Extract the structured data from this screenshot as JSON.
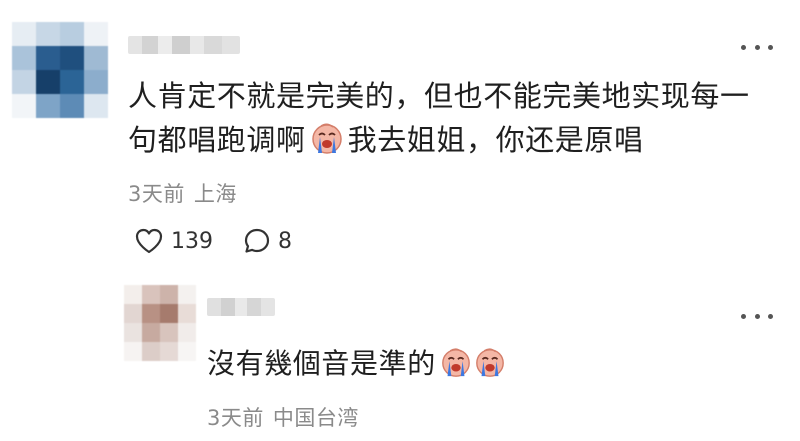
{
  "comment": {
    "text_line1": "人肯定不就是完美的，但也不能完美地实现每一",
    "text_line2a": "句都唱跑调啊",
    "text_line2b": "我去姐姐，你还是原唱",
    "emoji": "crying-face-emoji",
    "time": "3天前",
    "location": "上海",
    "likes": "139",
    "replies": "8"
  },
  "reply": {
    "text": "沒有幾個音是準的",
    "emoji": "crying-face-emoji",
    "emoji_count": 2,
    "time": "3天前",
    "location": "中国台湾"
  },
  "icons": {
    "like": "heart-outline-icon",
    "reply": "speech-bubble-outline-icon",
    "more": "more-dots-icon"
  },
  "colors": {
    "text": "#1f1f1f",
    "meta": "#8a8a8a",
    "icon": "#333333",
    "emoji_face": "#f4b7a6",
    "emoji_tears": "#3d78e0"
  }
}
